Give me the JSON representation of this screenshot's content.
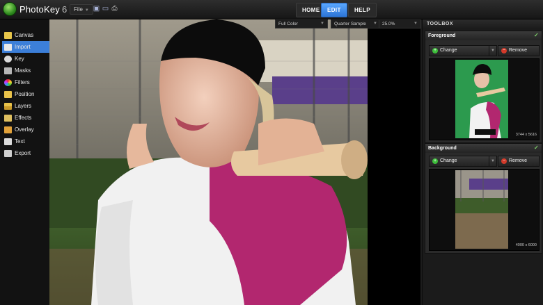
{
  "app": {
    "name": "PhotoKey",
    "version": "6"
  },
  "menu": {
    "file_label": "File"
  },
  "nav": {
    "home": "HOME",
    "edit": "EDIT",
    "help": "HELP"
  },
  "view_options": {
    "color_mode": "Full Color",
    "sample": "Quarter Sample",
    "zoom": "25.0%"
  },
  "sidebar": {
    "items": [
      {
        "label": "Canvas",
        "icon": "canvas-icon",
        "color": "#e8c64a"
      },
      {
        "label": "Import",
        "icon": "import-icon",
        "color": "#e9e9e9"
      },
      {
        "label": "Key",
        "icon": "key-icon",
        "color": "#d9d9d9"
      },
      {
        "label": "Masks",
        "icon": "masks-icon",
        "color": "#b7b7b7"
      },
      {
        "label": "Filters",
        "icon": "filters-icon",
        "color": "#d84fb0"
      },
      {
        "label": "Position",
        "icon": "position-icon",
        "color": "#e9c24a"
      },
      {
        "label": "Layers",
        "icon": "layers-icon",
        "color": "#e9c24a"
      },
      {
        "label": "Effects",
        "icon": "effects-icon",
        "color": "#e0c060"
      },
      {
        "label": "Overlay",
        "icon": "overlay-icon",
        "color": "#e2a23a"
      },
      {
        "label": "Text",
        "icon": "text-icon",
        "color": "#dcdcdc"
      },
      {
        "label": "Export",
        "icon": "export-icon",
        "color": "#cfcfcf"
      }
    ],
    "active_index": 1
  },
  "toolbox": {
    "title": "TOOLBOX",
    "foreground": {
      "title": "Foreground",
      "change_label": "Change",
      "remove_label": "Remove",
      "size": "3744 x 5616"
    },
    "background": {
      "title": "Background",
      "change_label": "Change",
      "remove_label": "Remove",
      "size": "4000 x 6000"
    }
  },
  "colors": {
    "accent": "#3c7fd9",
    "add": "#3dbd3a",
    "remove": "#d23a2a",
    "green_screen": "#2c9a4e"
  }
}
